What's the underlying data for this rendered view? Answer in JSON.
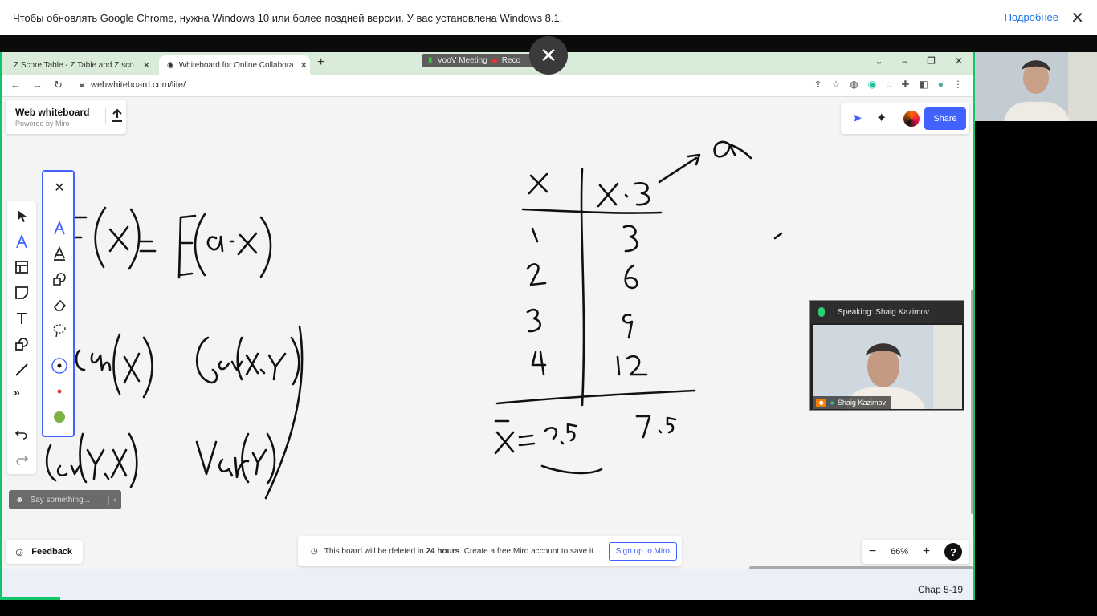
{
  "notice": {
    "text": "Чтобы обновлять Google Chrome, нужна Windows 10 или более поздней версии. У вас установлена Windows 8.1.",
    "link": "Подробнее",
    "close": "✕"
  },
  "share_close": "✕",
  "browser": {
    "tabs": [
      {
        "label": "Z Score Table - Z Table and Z sco",
        "close": "✕"
      },
      {
        "label": "Whiteboard for Online Collabora",
        "close": "✕"
      }
    ],
    "new_tab": "+",
    "meeting_pill": {
      "name": "VooV Meeting",
      "rec": "Reco"
    },
    "url": "webwhiteboard.com/lite/"
  },
  "whiteboard": {
    "title": "Web whiteboard",
    "subtitle": "Powered by Miro",
    "share_label": "Share",
    "say_placeholder": "Say something...",
    "feedback_label": "Feedback",
    "delete_notice": {
      "prefix": "This board will be deleted in",
      "bold": "24 hours",
      "suffix": ". Create a free Miro account to save it."
    },
    "signup_label": "Sign up to Miro",
    "zoom": {
      "minus": "−",
      "value": "66%",
      "plus": "+",
      "help": "?"
    },
    "close_panel": "✕"
  },
  "meeting": {
    "speaking": "Speaking: Shaig Kazimov",
    "name": "Shaig Kazimov"
  },
  "footer": {
    "chap": "Chap 5-19"
  },
  "colors": {
    "accent": "#4262ff",
    "frame": "#12c46a",
    "pen_red": "#e53935",
    "pen_green": "#7cb342"
  }
}
